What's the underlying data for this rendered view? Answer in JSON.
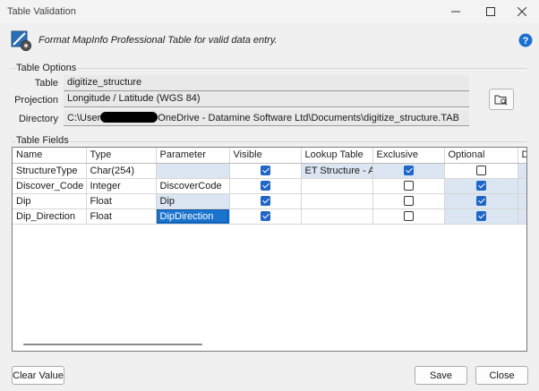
{
  "window": {
    "title": "Table Validation",
    "description": "Format MapInfo Professional Table for valid data entry."
  },
  "table_options": {
    "group_label": "Table Options",
    "table_label": "Table",
    "table_value": "digitize_structure",
    "projection_label": "Projection",
    "projection_value": "Longitude / Latitude (WGS 84)",
    "directory_label": "Directory",
    "directory_prefix": "C:\\User",
    "directory_suffix": "OneDrive - Datamine Software Ltd\\Documents\\digitize_structure.TAB"
  },
  "table_fields": {
    "group_label": "Table Fields",
    "columns": [
      "Name",
      "Type",
      "Parameter",
      "Visible",
      "Lookup Table",
      "Exclusive",
      "Optional",
      "D"
    ],
    "rows": [
      {
        "name": "StructureType",
        "type": "Char(254)",
        "parameter": "",
        "visible": true,
        "lookup": "ET Structure - Au...",
        "exclusive": true,
        "optional": false
      },
      {
        "name": "Discover_Code",
        "type": "Integer",
        "parameter": "DiscoverCode",
        "visible": true,
        "lookup": "",
        "exclusive": false,
        "optional": true
      },
      {
        "name": "Dip",
        "type": "Float",
        "parameter": "Dip",
        "visible": true,
        "lookup": "",
        "exclusive": false,
        "optional": true
      },
      {
        "name": "Dip_Direction",
        "type": "Float",
        "parameter": "DipDirection",
        "visible": true,
        "lookup": "",
        "exclusive": false,
        "optional": true
      }
    ]
  },
  "buttons": {
    "clear_value": "Clear Value",
    "save": "Save",
    "close": "Close"
  },
  "colors": {
    "selection": "#1a73cf",
    "shaded_cell": "#dbe6f2",
    "checkbox_checked": "#1e66c8"
  }
}
